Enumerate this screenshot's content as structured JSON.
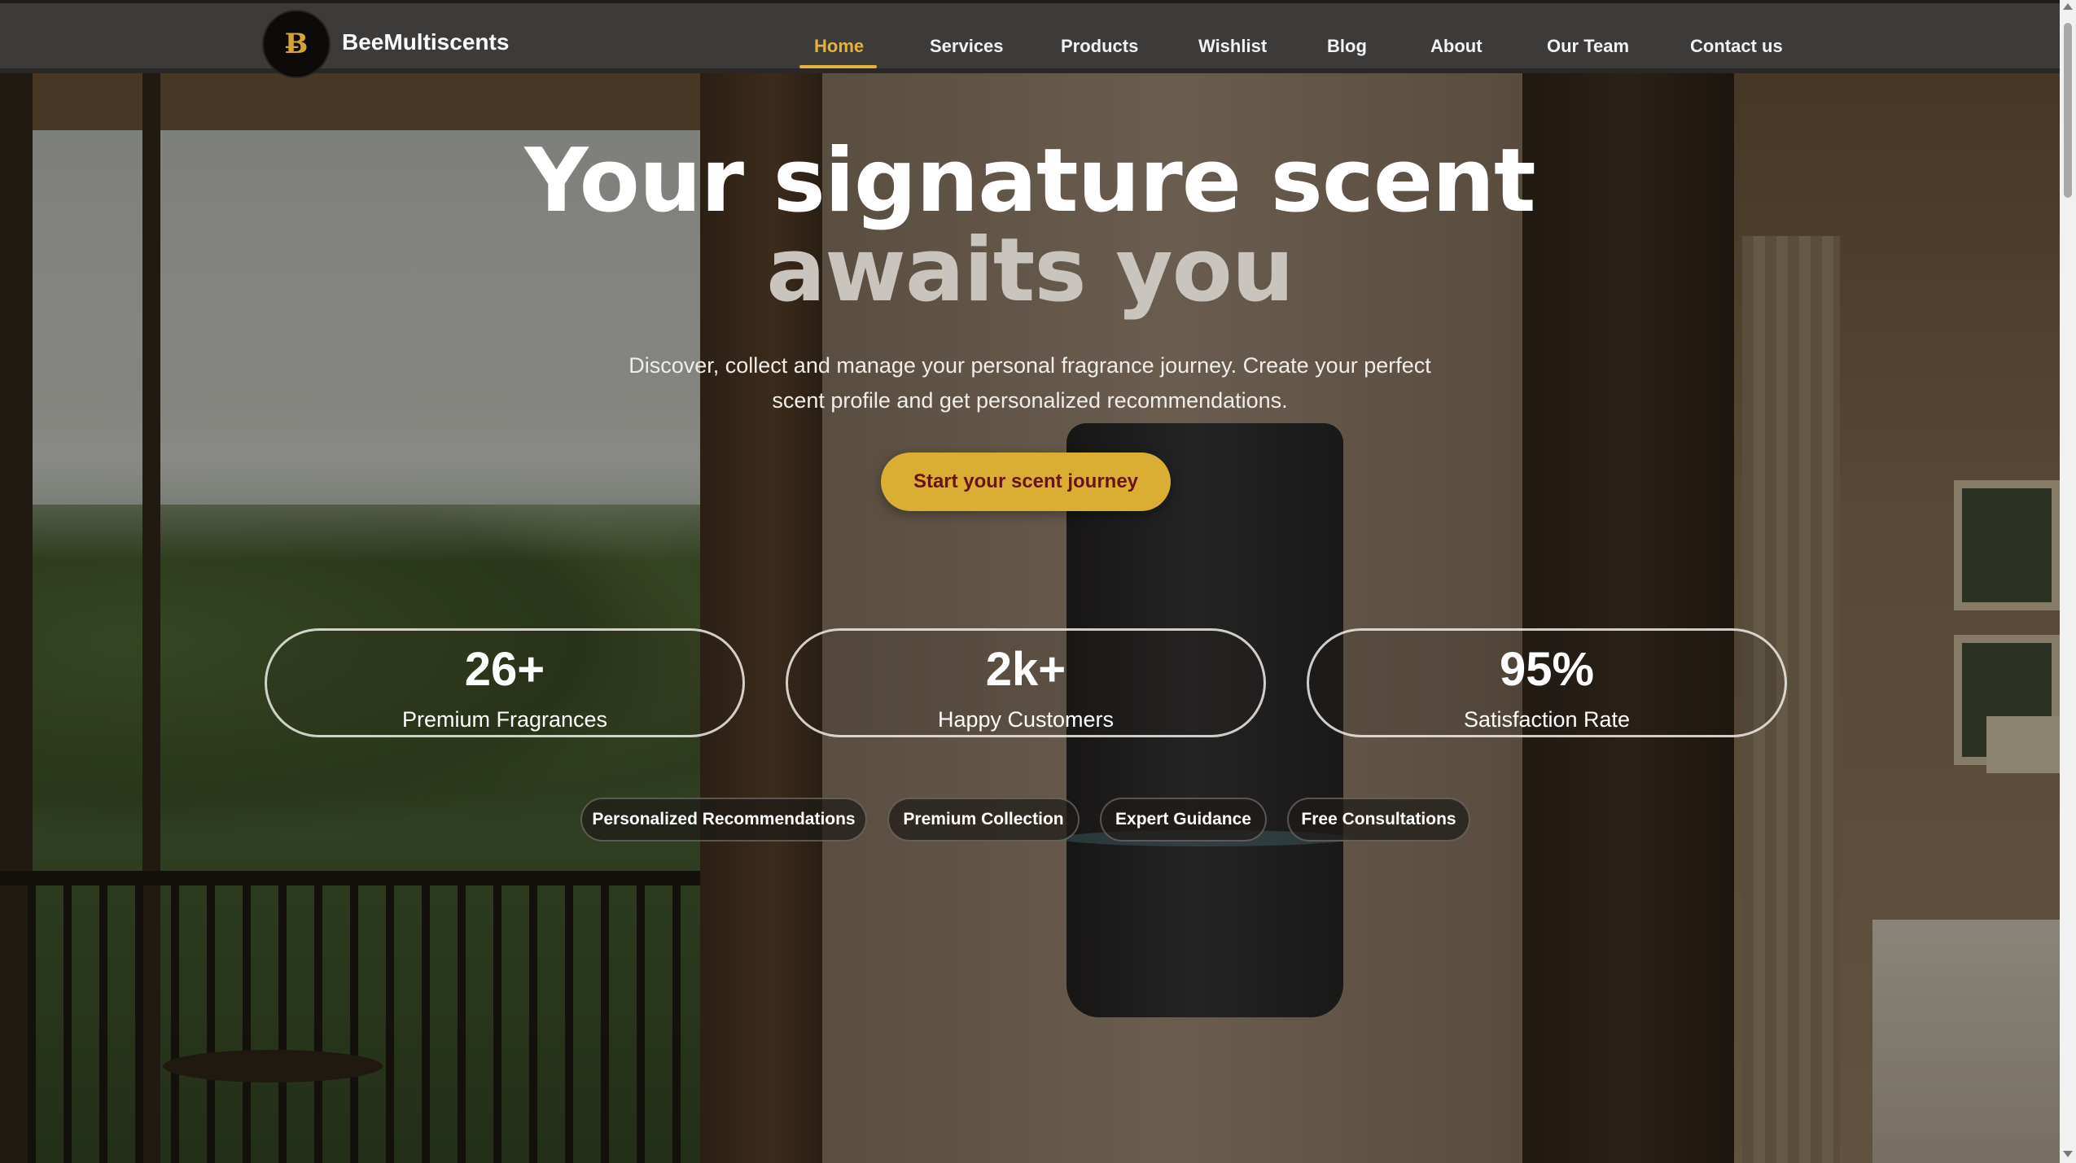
{
  "brand": {
    "name": "BeeMultiscents",
    "logo_icon": "bee-logo-icon"
  },
  "nav": {
    "items": [
      {
        "label": "Home",
        "active": true
      },
      {
        "label": "Services",
        "active": false
      },
      {
        "label": "Products",
        "active": false
      },
      {
        "label": "Wishlist",
        "active": false
      },
      {
        "label": "Blog",
        "active": false
      },
      {
        "label": "About",
        "active": false
      },
      {
        "label": "Our Team",
        "active": false
      },
      {
        "label": "Contact us",
        "active": false
      }
    ]
  },
  "hero": {
    "title_line1": "Your signature scent",
    "title_line2": "awaits you",
    "subtitle": "Discover, collect and manage your personal fragrance journey. Create your perfect scent profile and get personalized recommendations.",
    "cta_label": "Start your scent journey"
  },
  "stats": [
    {
      "value": "26+",
      "label": "Premium Fragrances"
    },
    {
      "value": "2k+",
      "label": "Happy Customers"
    },
    {
      "value": "95%",
      "label": "Satisfaction Rate"
    }
  ],
  "features": [
    "Personalized Recommendations",
    "Premium Collection",
    "Expert Guidance",
    "Free Consultations"
  ],
  "colors": {
    "accent": "#e5b33a",
    "cta_background": "#d9ae33",
    "cta_text": "#6a1410",
    "navbar": "#3d3b39"
  }
}
